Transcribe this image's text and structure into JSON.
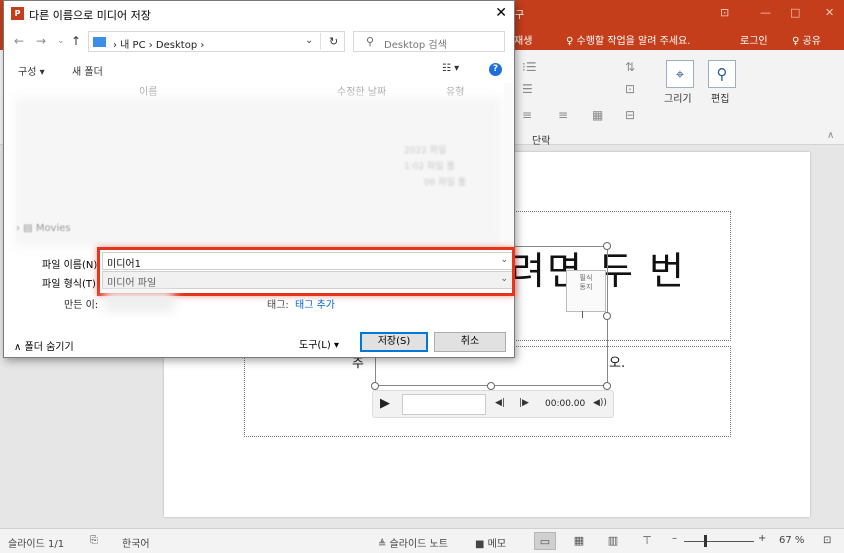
{
  "ppt": {
    "tab_partial_1": "구",
    "tab_partial_2": "재생",
    "tell_me": "♀ 수행할 작업을 알려 주세요.",
    "login": "로그인",
    "share": "♀ 공유",
    "draw_label": "그리기",
    "edit_label": "편집",
    "paragraph_group": "단락",
    "slide_title_fragment": "려면 두 번",
    "slide_sub_left": "추",
    "slide_sub_right": "오.",
    "media_icon_text": "필식\n동지",
    "media_time": "00:00.00"
  },
  "status": {
    "slide_count": "슬라이드 1/1",
    "language": "한국어",
    "notes": "≜ 슬라이드 노트",
    "comments": "■ 메모",
    "zoom": "67 %"
  },
  "dialog": {
    "title": "다른 이름으로 미디어 저장",
    "close": "✕",
    "address": {
      "segments": "› 내 PC  ›  Desktop  ›"
    },
    "search": {
      "placeholder": "Desktop 검색"
    },
    "toolbar": {
      "organize": "구성 ▾",
      "new_folder": "새 폴더"
    },
    "columns": {
      "name": "이름",
      "modified": "수정한 날짜",
      "type": "유형"
    },
    "sidebar_item": "Movies",
    "file_name_label": "파일 이름(N):",
    "file_name_value": "미디어1",
    "file_type_label": "파일 형식(T):",
    "file_type_value": "미디어 파일",
    "authors_label": "만든 이:",
    "tags_label": "태그:",
    "tags_value": "태그 추가",
    "hide_folders": "∧ 폴더 숨기기",
    "tools": "도구(L)  ▾",
    "save": "저장(S)",
    "cancel": "취소"
  },
  "colors": {
    "ppt_accent": "#c43e1c",
    "highlight": "#e5361d",
    "link": "#0066cc"
  }
}
